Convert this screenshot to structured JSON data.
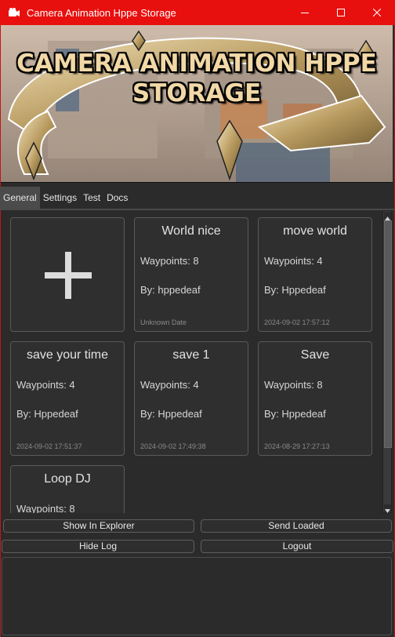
{
  "window": {
    "title": "Camera Animation Hppe Storage",
    "minimize_icon": "minimize-icon",
    "maximize_icon": "maximize-icon",
    "close_icon": "close-icon",
    "titlebar_color": "#e8100e"
  },
  "banner": {
    "title_line1": "CAMERA ANIMATION HPPE",
    "title_line2": "STORAGE"
  },
  "tabs": [
    {
      "label": "General",
      "active": true
    },
    {
      "label": "Settings",
      "active": false
    },
    {
      "label": "Test",
      "active": false
    },
    {
      "label": "Docs",
      "active": false
    }
  ],
  "add_card": {
    "icon": "plus-icon"
  },
  "cards": [
    {
      "title": "World nice",
      "waypoints": "Waypoints: 8",
      "author": "By: hppedeaf",
      "date": "Unknown Date"
    },
    {
      "title": "move world",
      "waypoints": "Waypoints: 4",
      "author": "By: Hppedeaf",
      "date": "2024-09-02 17:57:12"
    },
    {
      "title": "save your time",
      "waypoints": "Waypoints: 4",
      "author": "By: Hppedeaf",
      "date": "2024-09-02 17:51:37"
    },
    {
      "title": "save 1",
      "waypoints": "Waypoints: 4",
      "author": "By: Hppedeaf",
      "date": "2024-09-02 17:49:38"
    },
    {
      "title": "Save",
      "waypoints": "Waypoints: 8",
      "author": "By: Hppedeaf",
      "date": "2024-08-29 17:27:13"
    },
    {
      "title": "Loop DJ",
      "waypoints": "Waypoints: 8",
      "author": "",
      "date": ""
    }
  ],
  "buttons": {
    "show_in_explorer": "Show In Explorer",
    "send_loaded": "Send Loaded",
    "hide_log": "Hide Log",
    "logout": "Logout"
  }
}
